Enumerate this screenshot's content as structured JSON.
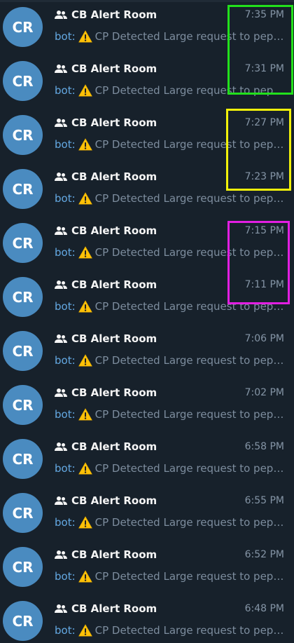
{
  "chats": [
    {
      "avatar": "CR",
      "title": "CB Alert Room",
      "time": "7:35 PM",
      "sender": "bot:",
      "preview": "CP Detected Large request to peplink"
    },
    {
      "avatar": "CR",
      "title": "CB Alert Room",
      "time": "7:31 PM",
      "sender": "bot:",
      "preview": "CP Detected Large request to peplink"
    },
    {
      "avatar": "CR",
      "title": "CB Alert Room",
      "time": "7:27 PM",
      "sender": "bot:",
      "preview": "CP Detected Large request to peplink"
    },
    {
      "avatar": "CR",
      "title": "CB Alert Room",
      "time": "7:23 PM",
      "sender": "bot:",
      "preview": "CP Detected Large request to peplink"
    },
    {
      "avatar": "CR",
      "title": "CB Alert Room",
      "time": "7:15 PM",
      "sender": "bot:",
      "preview": "CP Detected Large request to peplink"
    },
    {
      "avatar": "CR",
      "title": "CB Alert Room",
      "time": "7:11 PM",
      "sender": "bot:",
      "preview": "CP Detected Large request to peplink"
    },
    {
      "avatar": "CR",
      "title": "CB Alert Room",
      "time": "7:06 PM",
      "sender": "bot:",
      "preview": "CP Detected Large request to peplink"
    },
    {
      "avatar": "CR",
      "title": "CB Alert Room",
      "time": "7:02 PM",
      "sender": "bot:",
      "preview": "CP Detected Large request to peplink"
    },
    {
      "avatar": "CR",
      "title": "CB Alert Room",
      "time": "6:58 PM",
      "sender": "bot:",
      "preview": "CP Detected Large request to peplink"
    },
    {
      "avatar": "CR",
      "title": "CB Alert Room",
      "time": "6:55 PM",
      "sender": "bot:",
      "preview": "CP Detected Large request to peplink"
    },
    {
      "avatar": "CR",
      "title": "CB Alert Room",
      "time": "6:52 PM",
      "sender": "bot:",
      "preview": "CP Detected Large request to peplink"
    },
    {
      "avatar": "CR",
      "title": "CB Alert Room",
      "time": "6:48 PM",
      "sender": "bot:",
      "preview": "CP Detected Large request to peplink"
    }
  ],
  "icons": {
    "group": "group-icon",
    "warning": "warning-icon"
  },
  "colors": {
    "background": "#17212b",
    "avatar": "#4a8bc0",
    "sender": "#64a9e3",
    "highlight_green": "#22e01c",
    "highlight_yellow": "#f2f20a",
    "highlight_magenta": "#e21ee2"
  }
}
